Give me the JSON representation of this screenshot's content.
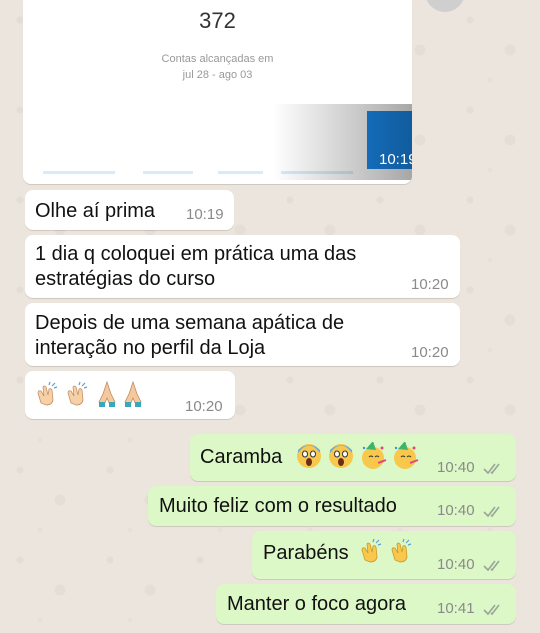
{
  "image_card": {
    "reach_count": "372",
    "caption_line1": "Contas alcançadas em",
    "caption_line2": "jul 28 - ago 03",
    "time": "10:19"
  },
  "incoming": [
    {
      "text": "Olhe aí prima",
      "time": "10:19"
    },
    {
      "text_line1": "1 dia q coloquei em prática uma das",
      "text_line2": "estratégias do curso",
      "time": "10:20"
    },
    {
      "text_line1": "Depois de uma semana apática de",
      "text_line2": "interação no perfil da Loja",
      "time": "10:20"
    },
    {
      "emojis": [
        "clapping-hands",
        "clapping-hands",
        "folded-hands",
        "folded-hands"
      ],
      "time": "10:20"
    }
  ],
  "outgoing": [
    {
      "text": "Caramba",
      "emojis": [
        "screaming-face",
        "screaming-face",
        "partying-face",
        "partying-face"
      ],
      "time": "10:40"
    },
    {
      "text": "Muito feliz com o resultado",
      "time": "10:40"
    },
    {
      "text": "Parabéns",
      "emojis": [
        "clapping-hands",
        "clapping-hands"
      ],
      "time": "10:40"
    },
    {
      "text": "Manter o foco agora",
      "time": "10:41"
    }
  ],
  "colors": {
    "incoming_bubble": "#ffffff",
    "outgoing_bubble": "#dcf8c6",
    "read_ticks": "#9aa59a",
    "chat_background": "#ece5dd"
  }
}
